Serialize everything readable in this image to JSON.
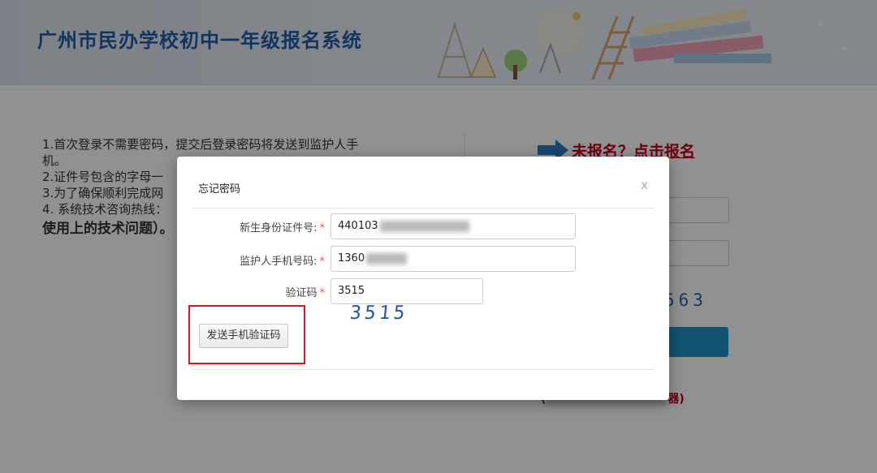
{
  "header": {
    "title": "广州市民办学校初中一年级报名系统"
  },
  "notes": {
    "line1": "1.首次登录不需要密码，提交后登录密码将发送到监护人手",
    "line1b": "机。",
    "line2": "2.证件号包含的字母一",
    "line3": "3.为了确保顺利完成网",
    "line4": "4. 系统技术咨询热线：",
    "line5": "使用上的技术问题）。"
  },
  "right_panel": {
    "signup_link": "未报名？点击报名",
    "captcha": "563",
    "browser_note_end": "器)"
  },
  "modal": {
    "title": "忘记密码",
    "close": "x",
    "fields": [
      {
        "label": "新生身份证件号:",
        "required_mark": "*",
        "value": "440103"
      },
      {
        "label": "监护人手机号码:",
        "required_mark": "*",
        "value": "1360"
      },
      {
        "label": "验证码",
        "required_mark": "*",
        "value": "3515"
      }
    ],
    "captcha_image_text": "3515",
    "send_button": "发送手机验证码"
  },
  "colors": {
    "title_blue": "#1f5da9",
    "link_red": "#c0001a",
    "highlight_red": "#e0141d",
    "button_blue": "#2193c9"
  }
}
